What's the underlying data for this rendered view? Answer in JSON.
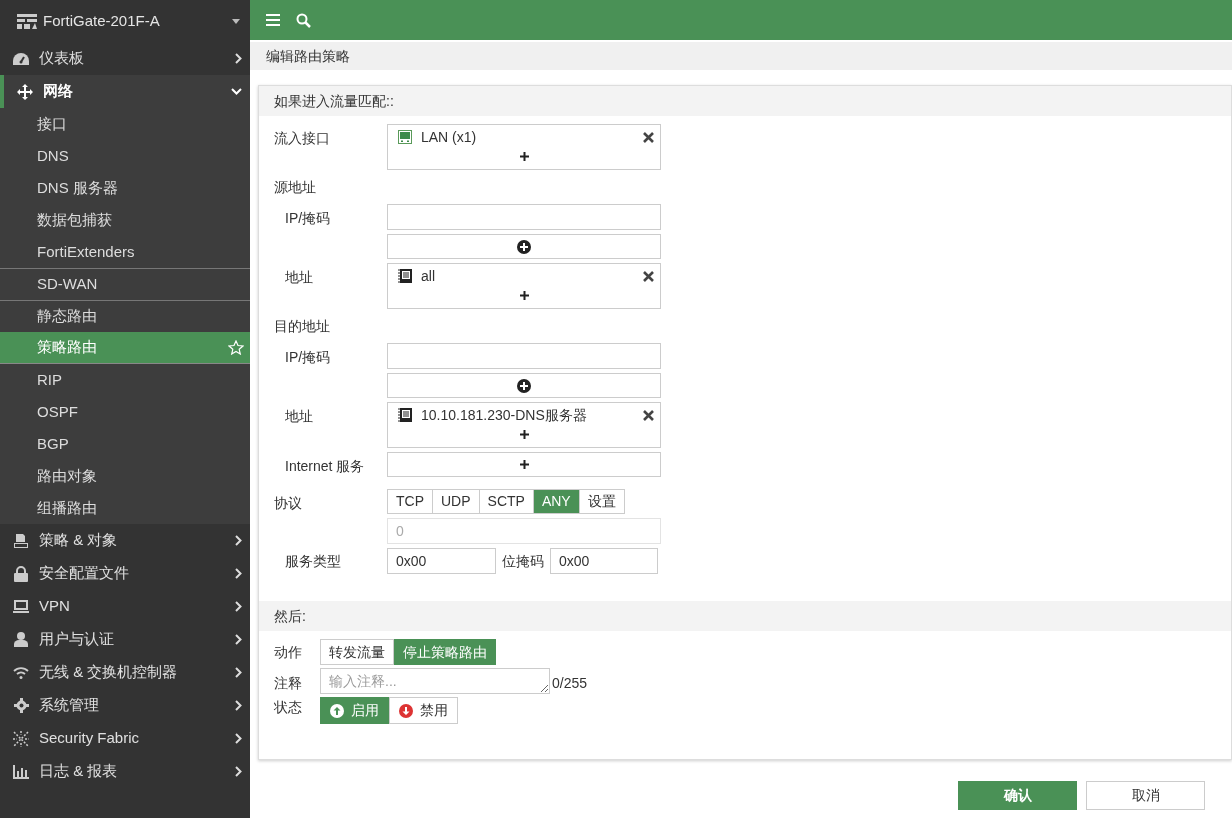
{
  "sidebar": {
    "device": "FortiGate-201F-A",
    "items": [
      {
        "label": "仪表板",
        "expanded": false
      },
      {
        "label": "网络",
        "expanded": true,
        "children": [
          {
            "label": "接口",
            "selected": false,
            "separator_above": false
          },
          {
            "label": "DNS",
            "selected": false,
            "separator_above": false
          },
          {
            "label": "DNS 服务器",
            "selected": false,
            "separator_above": false
          },
          {
            "label": "数据包捕获",
            "selected": false,
            "separator_above": false
          },
          {
            "label": "FortiExtenders",
            "selected": false,
            "separator_above": false
          },
          {
            "label": "SD-WAN",
            "selected": false,
            "separator_above": true
          },
          {
            "label": "静态路由",
            "selected": false,
            "separator_above": true
          },
          {
            "label": "策略路由",
            "selected": true,
            "separator_above": false
          },
          {
            "label": "RIP",
            "selected": false,
            "separator_above": false
          },
          {
            "label": "OSPF",
            "selected": false,
            "separator_above": false
          },
          {
            "label": "BGP",
            "selected": false,
            "separator_above": false
          },
          {
            "label": "路由对象",
            "selected": false,
            "separator_above": false
          },
          {
            "label": "组播路由",
            "selected": false,
            "separator_above": false
          }
        ]
      },
      {
        "label": "策略 & 对象",
        "expanded": false
      },
      {
        "label": "安全配置文件",
        "expanded": false
      },
      {
        "label": "VPN",
        "expanded": false
      },
      {
        "label": "用户与认证",
        "expanded": false
      },
      {
        "label": "无线 & 交换机控制器",
        "expanded": false
      },
      {
        "label": "系统管理",
        "expanded": false
      },
      {
        "label": "Security Fabric",
        "expanded": false
      },
      {
        "label": "日志 & 报表",
        "expanded": false
      }
    ]
  },
  "page_title": "编辑路由策略",
  "match_section": {
    "heading": "如果进入流量匹配::",
    "incoming_interface": {
      "label": "流入接口",
      "entries": [
        "LAN (x1)"
      ]
    },
    "source": {
      "label": "源地址",
      "ip_mask_label": "IP/掩码",
      "address_label": "地址",
      "addresses": [
        "all"
      ]
    },
    "destination": {
      "label": "目的地址",
      "ip_mask_label": "IP/掩码",
      "address_label": "地址",
      "addresses": [
        "10.10.181.230-DNS服务器"
      ]
    },
    "internet_service_label": "Internet 服务",
    "protocol": {
      "label": "协议",
      "options": [
        {
          "label": "TCP",
          "selected": false
        },
        {
          "label": "UDP",
          "selected": false
        },
        {
          "label": "SCTP",
          "selected": false
        },
        {
          "label": "ANY",
          "selected": true
        },
        {
          "label": "设置",
          "selected": false
        }
      ],
      "number": "0"
    },
    "tos": {
      "label": "服务类型",
      "value": "0x00",
      "bit_mask_label": "位掩码",
      "bit_mask": "0x00"
    }
  },
  "then_section": {
    "heading": "然后:",
    "action": {
      "label": "动作",
      "options": [
        {
          "label": "转发流量",
          "selected": false
        },
        {
          "label": "停止策略路由",
          "selected": true
        }
      ]
    },
    "comment": {
      "label": "注释",
      "placeholder": "输入注释...",
      "counter": "0/255"
    },
    "status": {
      "label": "状态",
      "options": [
        {
          "label": "启用",
          "selected": true
        },
        {
          "label": "禁用",
          "selected": false
        }
      ]
    }
  },
  "buttons": [
    {
      "label": "确认",
      "primary": true
    },
    {
      "label": "取消",
      "primary": false
    }
  ]
}
